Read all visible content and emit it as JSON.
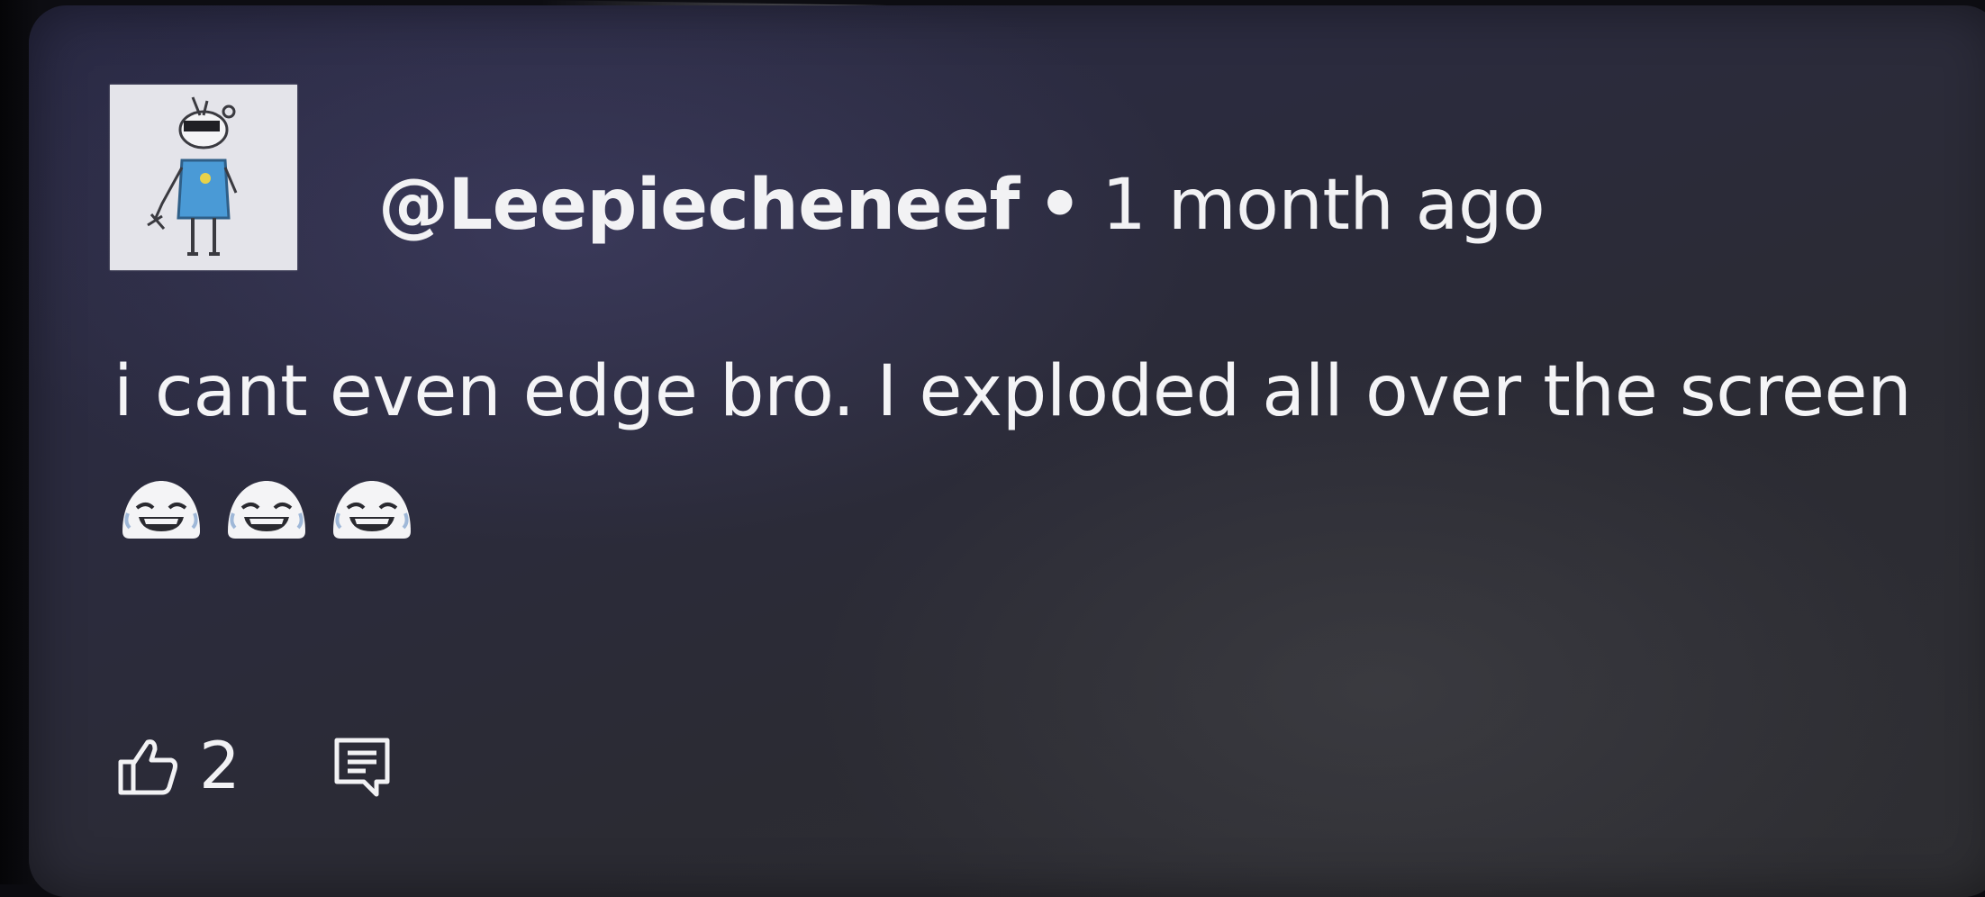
{
  "comment": {
    "author": "@Leepiecheneef",
    "separator": "•",
    "time_ago": "1 month ago",
    "text": "i cant even edge bro. I exploded all over the screen",
    "emojis": [
      "laughing-face-emoji",
      "laughing-face-emoji",
      "laughing-face-emoji"
    ]
  },
  "actions": {
    "like_icon": "thumbs-up-icon",
    "like_count": "2",
    "reply_icon": "reply-comment-icon"
  },
  "colors": {
    "card_background": "#2b2b3a",
    "text": "#f2f2f4",
    "avatar_background": "#e3e3e8"
  }
}
